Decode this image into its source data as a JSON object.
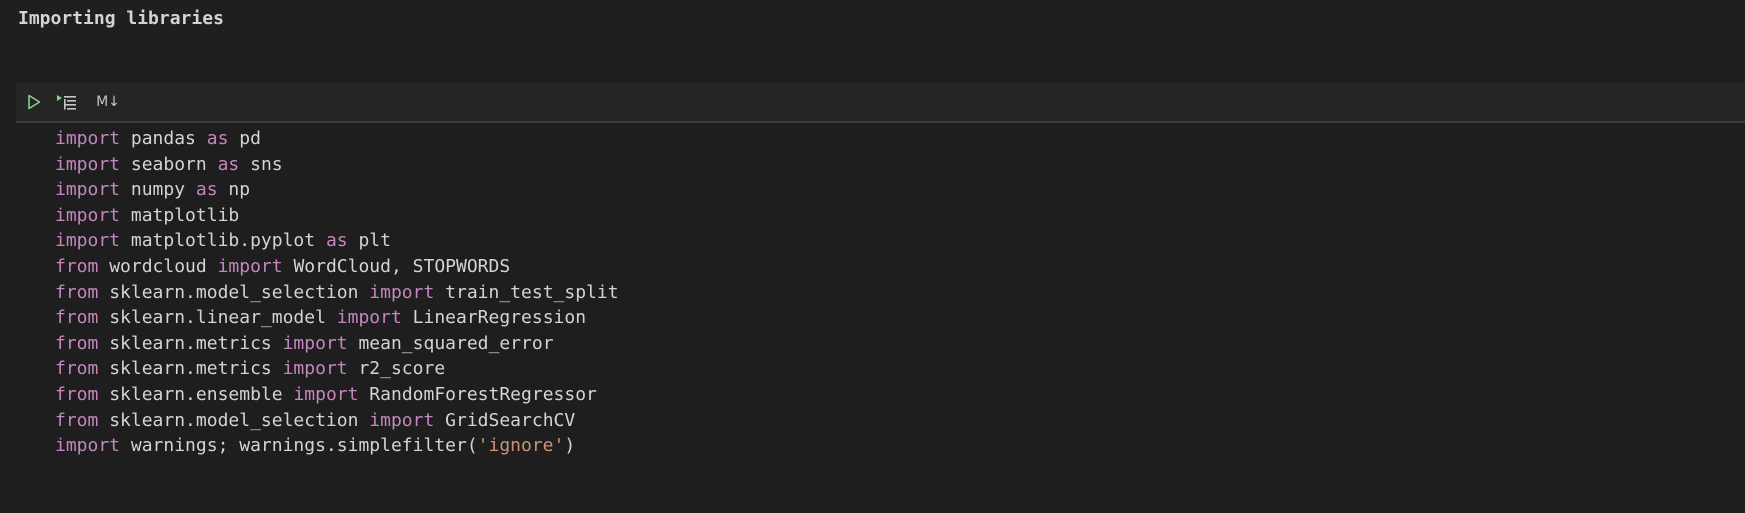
{
  "markdown_cell": {
    "text": "Importing libraries"
  },
  "toolbar": {
    "run_icon": "play-icon",
    "run_below_icon": "run-below-icon",
    "markdown_label": "M↓"
  },
  "colors": {
    "background": "#1f1f1f",
    "code_background": "#1e1e1e",
    "keyword": "#c586c0",
    "string": "#ce9178",
    "text": "#d4d4d4",
    "run_icon": "#89d185"
  },
  "code_lines": [
    [
      {
        "t": "import",
        "k": "kw"
      },
      {
        "t": " pandas "
      },
      {
        "t": "as",
        "k": "kw"
      },
      {
        "t": " pd"
      }
    ],
    [
      {
        "t": "import",
        "k": "kw"
      },
      {
        "t": " seaborn "
      },
      {
        "t": "as",
        "k": "kw"
      },
      {
        "t": " sns"
      }
    ],
    [
      {
        "t": "import",
        "k": "kw"
      },
      {
        "t": " numpy "
      },
      {
        "t": "as",
        "k": "kw"
      },
      {
        "t": " np"
      }
    ],
    [
      {
        "t": "import",
        "k": "kw"
      },
      {
        "t": " matplotlib"
      }
    ],
    [
      {
        "t": "import",
        "k": "kw"
      },
      {
        "t": " matplotlib.pyplot "
      },
      {
        "t": "as",
        "k": "kw"
      },
      {
        "t": " plt"
      }
    ],
    [
      {
        "t": "from",
        "k": "kw"
      },
      {
        "t": " wordcloud "
      },
      {
        "t": "import",
        "k": "kw"
      },
      {
        "t": " WordCloud, STOPWORDS"
      }
    ],
    [
      {
        "t": "from",
        "k": "kw"
      },
      {
        "t": " sklearn.model_selection "
      },
      {
        "t": "import",
        "k": "kw"
      },
      {
        "t": " train_test_split"
      }
    ],
    [
      {
        "t": "from",
        "k": "kw"
      },
      {
        "t": " sklearn.linear_model "
      },
      {
        "t": "import",
        "k": "kw"
      },
      {
        "t": " LinearRegression"
      }
    ],
    [
      {
        "t": "from",
        "k": "kw"
      },
      {
        "t": " sklearn.metrics "
      },
      {
        "t": "import",
        "k": "kw"
      },
      {
        "t": " mean_squared_error"
      }
    ],
    [
      {
        "t": "from",
        "k": "kw"
      },
      {
        "t": " sklearn.metrics "
      },
      {
        "t": "import",
        "k": "kw"
      },
      {
        "t": " r2_score"
      }
    ],
    [
      {
        "t": "from",
        "k": "kw"
      },
      {
        "t": " sklearn.ensemble "
      },
      {
        "t": "import",
        "k": "kw"
      },
      {
        "t": " RandomForestRegressor"
      }
    ],
    [
      {
        "t": "from",
        "k": "kw"
      },
      {
        "t": " sklearn.model_selection "
      },
      {
        "t": "import",
        "k": "kw"
      },
      {
        "t": " GridSearchCV"
      }
    ],
    [
      {
        "t": "import",
        "k": "kw"
      },
      {
        "t": " warnings; warnings.simplefilter("
      },
      {
        "t": "'ignore'",
        "k": "str"
      },
      {
        "t": ")"
      }
    ]
  ]
}
